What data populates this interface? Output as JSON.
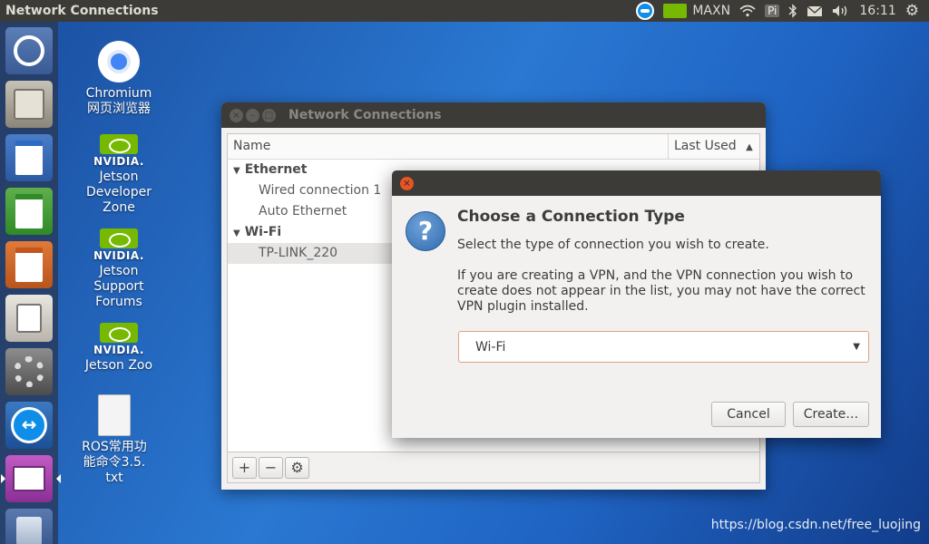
{
  "top_panel": {
    "app_title": "Network Connections",
    "nvidia_mode": "MAXN",
    "pi_label": "Pi",
    "clock": "16:11"
  },
  "desktop_icons": [
    {
      "id": "chromium",
      "label_line1": "Chromium",
      "label_line2": "网页浏览器"
    },
    {
      "id": "jetson-dev",
      "brand": "NVIDIA.",
      "label": "Jetson Developer Zone"
    },
    {
      "id": "jetson-forums",
      "brand": "NVIDIA.",
      "label": "Jetson Support Forums"
    },
    {
      "id": "jetson-zoo",
      "brand": "NVIDIA.",
      "label": "Jetson Zoo"
    },
    {
      "id": "ros-txt",
      "label_line1": "ROS常用功",
      "label_line2": "能命令3.5.",
      "label_line3": "txt"
    }
  ],
  "nc_window": {
    "title": "Network Connections",
    "columns": {
      "name": "Name",
      "last_used": "Last Used"
    },
    "groups": [
      {
        "name": "Ethernet",
        "items": [
          "Wired connection 1",
          "Auto Ethernet"
        ]
      },
      {
        "name": "Wi-Fi",
        "items": [
          "TP-LINK_220"
        ]
      }
    ],
    "toolbar": {
      "add": "+",
      "remove": "−",
      "settings": "⚙"
    }
  },
  "dialog": {
    "heading": "Choose a Connection Type",
    "subtitle": "Select the type of connection you wish to create.",
    "body": "If you are creating a VPN, and the VPN connection you wish to create does not appear in the list, you may not have the correct VPN plugin installed.",
    "selected_type": "Wi-Fi",
    "cancel_label": "Cancel",
    "create_label": "Create…"
  },
  "watermark": "https://blog.csdn.net/free_luojing",
  "colors": {
    "accent": "#e95420",
    "panel": "#3c3b37",
    "nvidia_green": "#76b900",
    "teamviewer_blue": "#0e8ee9"
  }
}
